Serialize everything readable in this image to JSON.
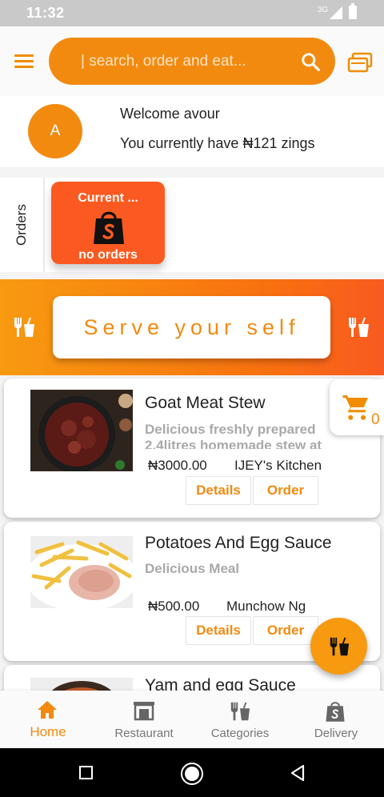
{
  "status_bar": {
    "time": "11:32",
    "network": "3G"
  },
  "search": {
    "placeholder": "| search, order and eat..."
  },
  "welcome": {
    "avatar_letter": "A",
    "greeting": "Welcome avour",
    "zings_prefix": "You currently have",
    "zings_amount": "₦121 zings"
  },
  "orders": {
    "label": "Orders",
    "card": {
      "title": "Current ...",
      "status": "no orders",
      "icon": "shopping-bag-icon"
    }
  },
  "serve_banner": {
    "text": "Serve your self"
  },
  "cart": {
    "count": "0"
  },
  "foods": [
    {
      "name": "Goat Meat Stew",
      "description": "Delicious freshly prepared 2.4litres homemade stew at",
      "price": "₦3000.00",
      "vendor": "IJEY's Kitchen",
      "details_label": "Details",
      "order_label": "Order"
    },
    {
      "name": "Potatoes And Egg Sauce",
      "description": "Delicious Meal",
      "price": "₦500.00",
      "vendor": "Munchow Ng",
      "details_label": "Details",
      "order_label": "Order"
    },
    {
      "name": "Yam and egg Sauce"
    }
  ],
  "bottom_nav": [
    {
      "label": "Home",
      "icon": "home-icon",
      "active": true
    },
    {
      "label": "Restaurant",
      "icon": "restaurant-icon",
      "active": false
    },
    {
      "label": "Categories",
      "icon": "utensils-icon",
      "active": false
    },
    {
      "label": "Delivery",
      "icon": "shopping-bag-icon",
      "active": false
    }
  ],
  "colors": {
    "accent": "#f28a10",
    "order_card": "#fa5a21"
  }
}
